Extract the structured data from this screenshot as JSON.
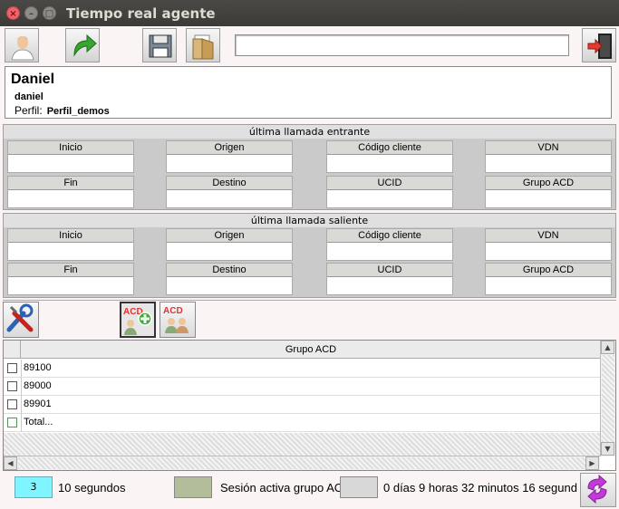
{
  "window": {
    "title": "Tiempo real agente",
    "controls": [
      "close-icon",
      "minimize-icon",
      "maximize-icon"
    ]
  },
  "toolbar": {
    "buttons": [
      {
        "icon": "user-icon"
      },
      {
        "icon": "redo-arrow-icon"
      },
      {
        "icon": "save-disk-icon"
      },
      {
        "icon": "folder-open-icon"
      },
      {
        "icon": "exit-door-icon"
      }
    ],
    "top_field_value": ""
  },
  "agent": {
    "name": "Daniel",
    "login": "daniel",
    "profile_label": "Perfil:",
    "profile_value": "Perfil_demos"
  },
  "incoming": {
    "title": "última llamada entrante",
    "fields": [
      {
        "label": "Inicio",
        "value": ""
      },
      {
        "label": "Origen",
        "value": ""
      },
      {
        "label": "Código cliente",
        "value": ""
      },
      {
        "label": "VDN",
        "value": ""
      },
      {
        "label": "Fin",
        "value": ""
      },
      {
        "label": "Destino",
        "value": ""
      },
      {
        "label": "UCID",
        "value": ""
      },
      {
        "label": "Grupo ACD",
        "value": ""
      }
    ]
  },
  "outgoing": {
    "title": "última llamada saliente",
    "fields": [
      {
        "label": "Inicio",
        "value": ""
      },
      {
        "label": "Origen",
        "value": ""
      },
      {
        "label": "Código cliente",
        "value": ""
      },
      {
        "label": "VDN",
        "value": ""
      },
      {
        "label": "Fin",
        "value": ""
      },
      {
        "label": "Destino",
        "value": ""
      },
      {
        "label": "UCID",
        "value": ""
      },
      {
        "label": "Grupo ACD",
        "value": ""
      }
    ]
  },
  "acd_toolbar": {
    "buttons": [
      {
        "icon": "tools-icon"
      },
      {
        "icon": "acd-add-icon",
        "text": "ACD"
      },
      {
        "icon": "acd-group-icon",
        "text": "ACD"
      }
    ]
  },
  "acd_grid": {
    "column": "Grupo ACD",
    "rows": [
      {
        "value": "89100",
        "checked": false
      },
      {
        "value": "89000",
        "checked": false
      },
      {
        "value": "89901",
        "checked": false
      },
      {
        "value": "Total...",
        "checked": false
      }
    ]
  },
  "status_bar": {
    "interval_value": "3",
    "interval_label": "10 segundos",
    "session_color": "#b3bd9b",
    "session_label": "Sesión activa grupo AC",
    "idle_color": "#d8d8d8",
    "elapsed": "0 días 9 horas 32 minutos 16 segund"
  },
  "colors": {
    "titlebar": "#3c3b37",
    "close": "#f46067",
    "interval_bg": "#7ff5ff",
    "app_bg": "#fbf4f4"
  }
}
